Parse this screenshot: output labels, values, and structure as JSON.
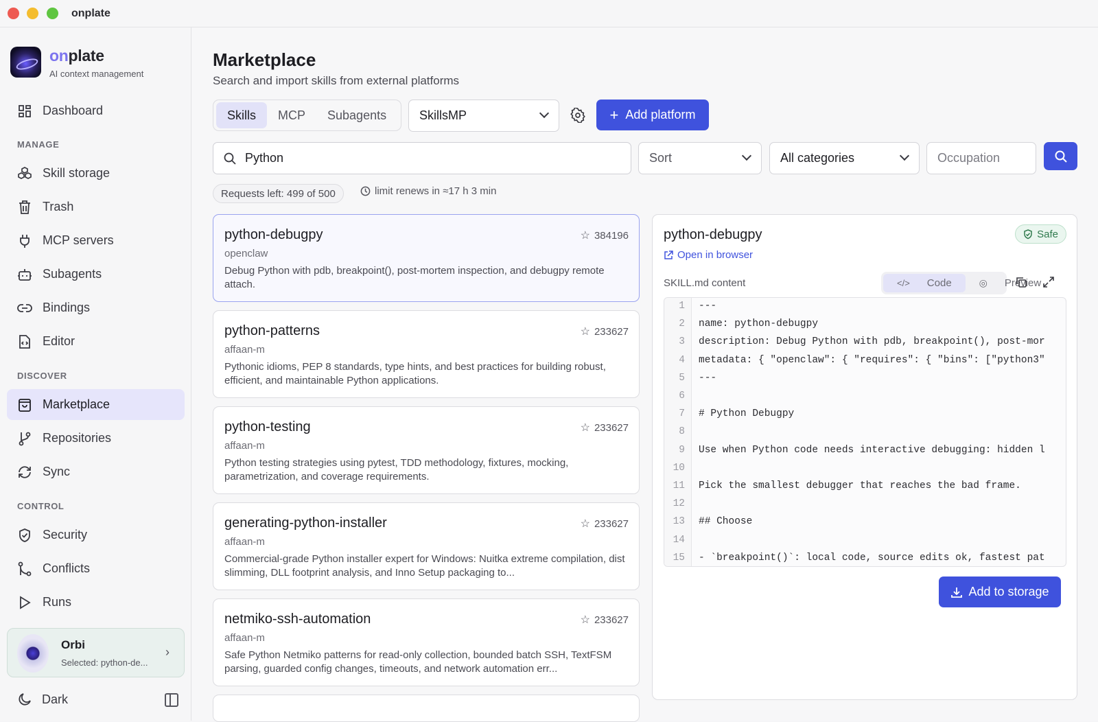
{
  "window": {
    "title": "onplate"
  },
  "brand": {
    "prefix": "on",
    "suffix": "plate",
    "tagline": "AI context management"
  },
  "sidebar": {
    "dashboard": "Dashboard",
    "sections": {
      "manage": "MANAGE",
      "discover": "DISCOVER",
      "control": "CONTROL"
    },
    "manage": [
      "Skill storage",
      "Trash",
      "MCP servers",
      "Subagents",
      "Bindings",
      "Editor"
    ],
    "discover": [
      "Marketplace",
      "Repositories",
      "Sync"
    ],
    "control": [
      "Security",
      "Conflicts",
      "Runs"
    ],
    "orbi": {
      "name": "Orbi",
      "selected": "Selected: python-de..."
    },
    "theme": "Dark"
  },
  "page": {
    "title": "Marketplace",
    "subtitle": "Search and import skills from external platforms",
    "tabs": [
      "Skills",
      "MCP",
      "Subagents"
    ],
    "active_tab": "Skills",
    "platform": "SkillsMP",
    "add_platform": "Add platform",
    "search_value": "Python",
    "sort": "Sort",
    "categories": "All categories",
    "occupation_placeholder": "Occupation",
    "requests": "Requests left: 499 of 500",
    "renews": "limit renews in ≈17 h 3 min"
  },
  "results": [
    {
      "name": "python-debugpy",
      "stars": "384196",
      "author": "openclaw",
      "desc": "Debug Python with pdb, breakpoint(), post-mortem inspection, and debugpy remote attach."
    },
    {
      "name": "python-patterns",
      "stars": "233627",
      "author": "affaan-m",
      "desc": "Pythonic idioms, PEP 8 standards, type hints, and best practices for building robust, efficient, and maintainable Python applications."
    },
    {
      "name": "python-testing",
      "stars": "233627",
      "author": "affaan-m",
      "desc": "Python testing strategies using pytest, TDD methodology, fixtures, mocking, parametrization, and coverage requirements."
    },
    {
      "name": "generating-python-installer",
      "stars": "233627",
      "author": "affaan-m",
      "desc": "Commercial-grade Python installer expert for Windows: Nuitka extreme compilation, dist slimming, DLL footprint analysis, and Inno Setup packaging to..."
    },
    {
      "name": "netmiko-ssh-automation",
      "stars": "233627",
      "author": "affaan-m",
      "desc": "Safe Python Netmiko patterns for read-only collection, bounded batch SSH, TextFSM parsing, guarded config changes, timeouts, and network automation err..."
    }
  ],
  "detail": {
    "title": "python-debugpy",
    "badge": "Safe",
    "open_link": "Open in browser",
    "content_label": "SKILL.md content",
    "view_code": "Code",
    "view_preview": "Preview",
    "code_lines": [
      "---",
      "name: python-debugpy",
      "description: Debug Python with pdb, breakpoint(), post-mor",
      "metadata: { \"openclaw\": { \"requires\": { \"bins\": [\"python3\"",
      "---",
      "",
      "# Python Debugpy",
      "",
      "Use when Python code needs interactive debugging: hidden l",
      "",
      "Pick the smallest debugger that reaches the bad frame.",
      "",
      "## Choose",
      "",
      "- `breakpoint()`: local code, source edits ok, fastest pat"
    ],
    "add_button": "Add to storage"
  }
}
